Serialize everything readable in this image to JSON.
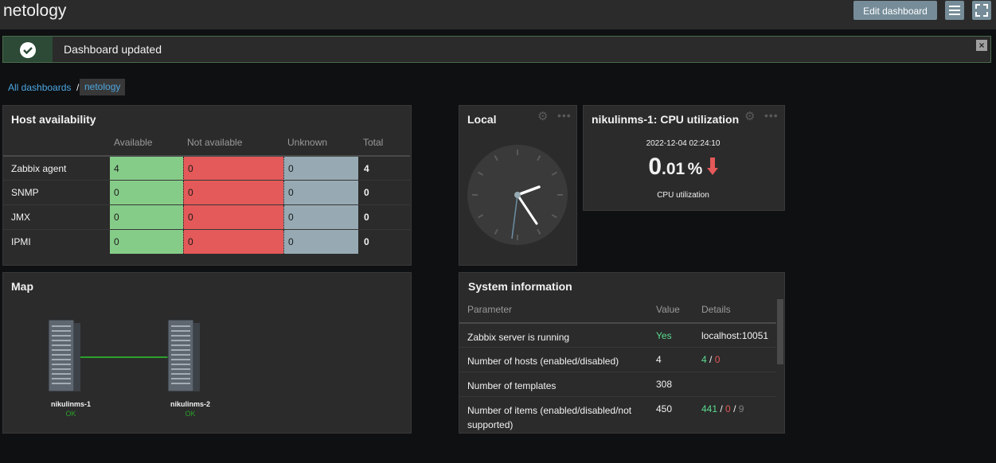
{
  "header": {
    "title": "netology",
    "edit_label": "Edit dashboard"
  },
  "message": {
    "text": "Dashboard updated"
  },
  "breadcrumb": {
    "all": "All dashboards",
    "separator": "/",
    "current": "netology"
  },
  "host_availability": {
    "title": "Host availability",
    "columns": [
      "Available",
      "Not available",
      "Unknown",
      "Total"
    ],
    "rows": [
      {
        "name": "Zabbix agent",
        "available": "4",
        "not_available": "0",
        "unknown": "0",
        "total": "4"
      },
      {
        "name": "SNMP",
        "available": "0",
        "not_available": "0",
        "unknown": "0",
        "total": "0"
      },
      {
        "name": "JMX",
        "available": "0",
        "not_available": "0",
        "unknown": "0",
        "total": "0"
      },
      {
        "name": "IPMI",
        "available": "0",
        "not_available": "0",
        "unknown": "0",
        "total": "0"
      }
    ]
  },
  "clock": {
    "title": "Local"
  },
  "cpu": {
    "title": "nikulinms-1: CPU utilization",
    "timestamp": "2022-12-04 02:24:10",
    "value_int": "0",
    "value_dec": ".01",
    "unit": "%",
    "label": "CPU utilization",
    "trend": "down"
  },
  "map": {
    "title": "Map",
    "nodes": [
      {
        "name": "nikulinms-1",
        "status": "OK"
      },
      {
        "name": "nikulinms-2",
        "status": "OK"
      }
    ]
  },
  "system_info": {
    "title": "System information",
    "columns": [
      "Parameter",
      "Value",
      "Details"
    ],
    "rows": [
      {
        "parameter": "Zabbix server is running",
        "value": "Yes",
        "details": "localhost:10051"
      },
      {
        "parameter": "Number of hosts (enabled/disabled)",
        "value": "4",
        "details_a": "4",
        "details_b": "0"
      },
      {
        "parameter": "Number of templates",
        "value": "308"
      },
      {
        "parameter": "Number of items (enabled/disabled/not supported)",
        "value": "450",
        "details_a": "441",
        "details_b": "0",
        "details_c": "9"
      }
    ]
  },
  "colors": {
    "available": "#86cc89",
    "not_available": "#e45959",
    "unknown": "#97aab3",
    "accent": "#4da6e0",
    "ok_green": "#59db8f"
  }
}
